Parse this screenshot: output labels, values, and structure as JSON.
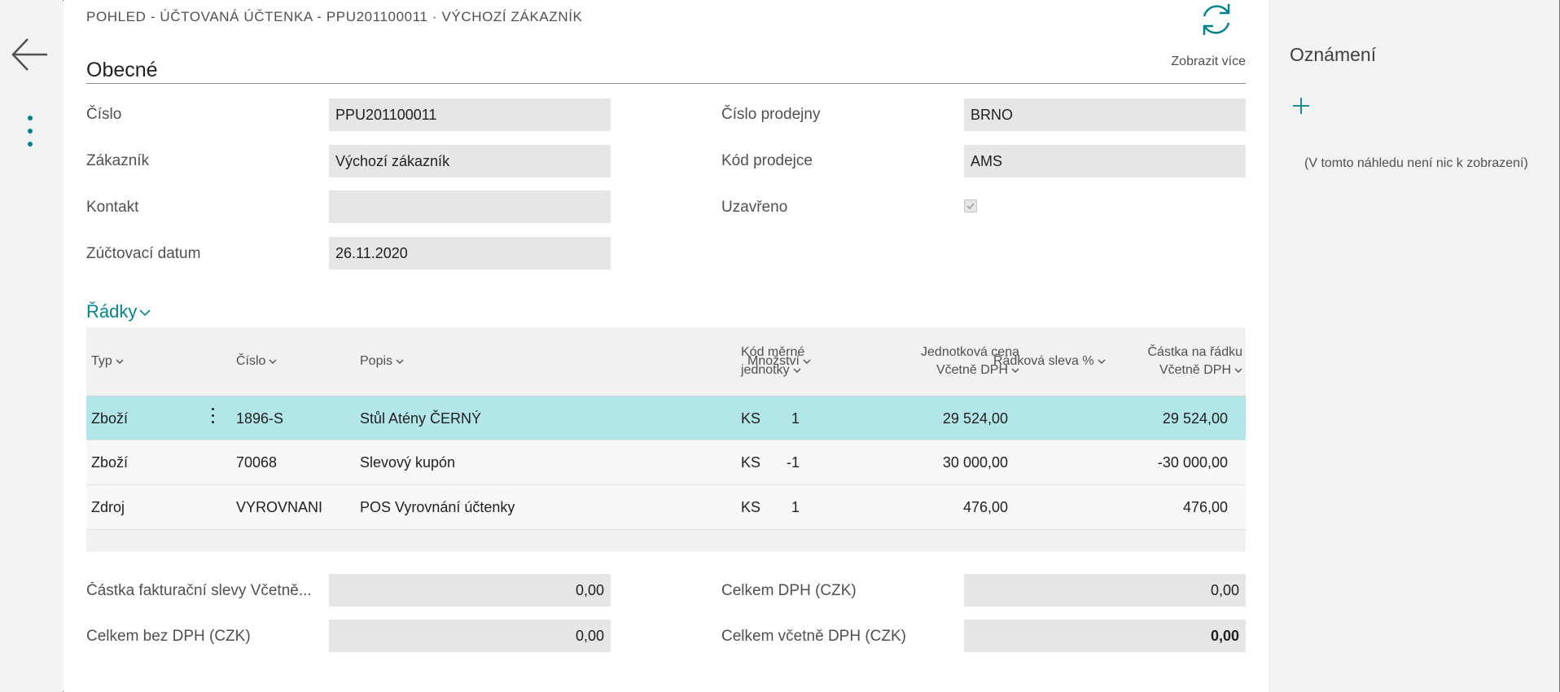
{
  "breadcrumb": "POHLED - ÚČTOVANÁ ÚČTENKA - PPU201100011 · VÝCHOZÍ ZÁKAZNÍK",
  "actions": {
    "back_icon": "arrow-left-icon",
    "more_icon": "vertical-ellipsis-icon",
    "refresh_icon": "refresh-icon",
    "show_more": "Zobrazit více"
  },
  "general": {
    "title": "Obecné",
    "left_fields": [
      {
        "label": "Číslo",
        "value": "PPU201100011"
      },
      {
        "label": "Zákazník",
        "value": "Výchozí zákazník"
      },
      {
        "label": "Kontakt",
        "value": ""
      },
      {
        "label": "Zúčtovací datum",
        "value": "26.11.2020"
      }
    ],
    "right_fields": [
      {
        "label": "Číslo prodejny",
        "value": "BRNO"
      },
      {
        "label": "Kód prodejce",
        "value": "AMS"
      },
      {
        "label": "Uzavřeno",
        "checked": true
      }
    ]
  },
  "lines": {
    "title": "Řádky",
    "columns": {
      "typ": "Typ",
      "cislo": "Číslo",
      "popis": "Popis",
      "mnozstvi": "Množství",
      "kod_mj_1": "Kód měrné",
      "kod_mj_2": "jednotky",
      "cena_1": "Jednotková cena",
      "cena_2": "Včetně DPH",
      "sleva": "Řádková sleva %",
      "castka_1": "Částka na řádku",
      "castka_2": "Včetně DPH"
    },
    "rows": [
      {
        "typ": "Zboží",
        "cislo": "1896-S",
        "popis": "Stůl Atény ČERNÝ",
        "mnozstvi": "1",
        "kod_mj": "KS",
        "cena": "29 524,00",
        "sleva": "",
        "castka": "29 524,00",
        "selected": true
      },
      {
        "typ": "Zboží",
        "cislo": "70068",
        "popis": "Slevový kupón",
        "mnozstvi": "-1",
        "kod_mj": "KS",
        "cena": "30 000,00",
        "sleva": "",
        "castka": "-30 000,00",
        "selected": false
      },
      {
        "typ": "Zdroj",
        "cislo": "VYROVNANI",
        "popis": "POS Vyrovnání účtenky",
        "mnozstvi": "1",
        "kod_mj": "KS",
        "cena": "476,00",
        "sleva": "",
        "castka": "476,00",
        "selected": false
      }
    ]
  },
  "totals": {
    "left": [
      {
        "label": "Částka fakturační slevy Včetně...",
        "value": "0,00"
      },
      {
        "label": "Celkem bez DPH (CZK)",
        "value": "0,00"
      }
    ],
    "right": [
      {
        "label": "Celkem DPH (CZK)",
        "value": "0,00"
      },
      {
        "label": "Celkem včetně DPH (CZK)",
        "value": "0,00"
      }
    ]
  },
  "notifications": {
    "title": "Oznámení",
    "add_icon": "plus-icon",
    "empty_text": "(V tomto náhledu není nic k zobrazení)"
  },
  "colors": {
    "accent": "#00838f",
    "selected_row": "#b2e6e8",
    "field_bg": "#e6e6e7"
  }
}
